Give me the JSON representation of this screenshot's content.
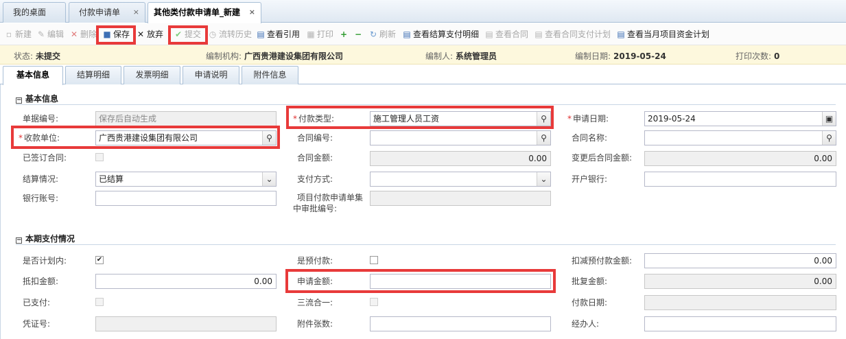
{
  "doc_tabs": [
    {
      "label": "我的桌面"
    },
    {
      "label": "付款申请单",
      "close": "×"
    },
    {
      "label": "其他类付款申请单_新建",
      "close": "×"
    }
  ],
  "toolbar": {
    "new": "新建",
    "edit": "编辑",
    "delete": "删除",
    "save": "保存",
    "discard": "放弃",
    "submit": "提交",
    "flow_history": "流转历史",
    "view_reference": "查看引用",
    "print": "打印",
    "refresh": "刷新",
    "view_settlement": "查看结算支付明细",
    "view_contract": "查看合同",
    "view_contract_plan": "查看合同支付计划",
    "view_month_plan": "查看当月项目资金计划"
  },
  "status": {
    "state_label": "状态:",
    "state_value": "未提交",
    "org_label": "编制机构:",
    "org_value": "广西贵港建设集团有限公司",
    "author_label": "编制人:",
    "author_value": "系统管理员",
    "date_label": "编制日期:",
    "date_value": "2019-05-24",
    "print_label": "打印次数:",
    "print_value": "0"
  },
  "subtabs": [
    "基本信息",
    "结算明细",
    "发票明细",
    "申请说明",
    "附件信息"
  ],
  "section1": {
    "title": "基本信息",
    "doc_no_label": "单据编号:",
    "doc_no_placeholder": "保存后自动生成",
    "pay_type_label": "付款类型:",
    "pay_type_value": "施工管理人员工资",
    "apply_date_label": "申请日期:",
    "apply_date_value": "2019-05-24",
    "payee_label": "收款单位:",
    "payee_value": "广西贵港建设集团有限公司",
    "contract_no_label": "合同编号:",
    "contract_name_label": "合同名称:",
    "signed_label": "已签订合同:",
    "contract_amount_label": "合同金额:",
    "contract_amount_value": "0.00",
    "changed_amount_label": "变更后合同金额:",
    "changed_amount_value": "0.00",
    "settle_label": "结算情况:",
    "settle_value": "已结算",
    "pay_method_label": "支付方式:",
    "bank_label": "开户银行:",
    "account_label": "银行账号:",
    "approval_no_label_1": "项目付款申请单集",
    "approval_no_label_2": "中审批编号:"
  },
  "section2": {
    "title": "本期支付情况",
    "planned_label": "是否计划内:",
    "prepay_label": "是预付款:",
    "deduct_prepay_label": "扣减预付款金额:",
    "deduct_prepay_value": "0.00",
    "offset_label": "抵扣金额:",
    "offset_value": "0.00",
    "apply_amount_label": "申请金额:",
    "approved_amount_label": "批复金额:",
    "approved_amount_value": "0.00",
    "paid_label": "已支付:",
    "three_in_one_label": "三流合一:",
    "pay_date_label": "付款日期:",
    "voucher_label": "凭证号:",
    "attach_count_label": "附件张数:",
    "handler_label": "经办人:"
  },
  "colors": {
    "highlight": "#e83a3a",
    "required": "#e03030",
    "status_bg": "#fdf8dd"
  }
}
